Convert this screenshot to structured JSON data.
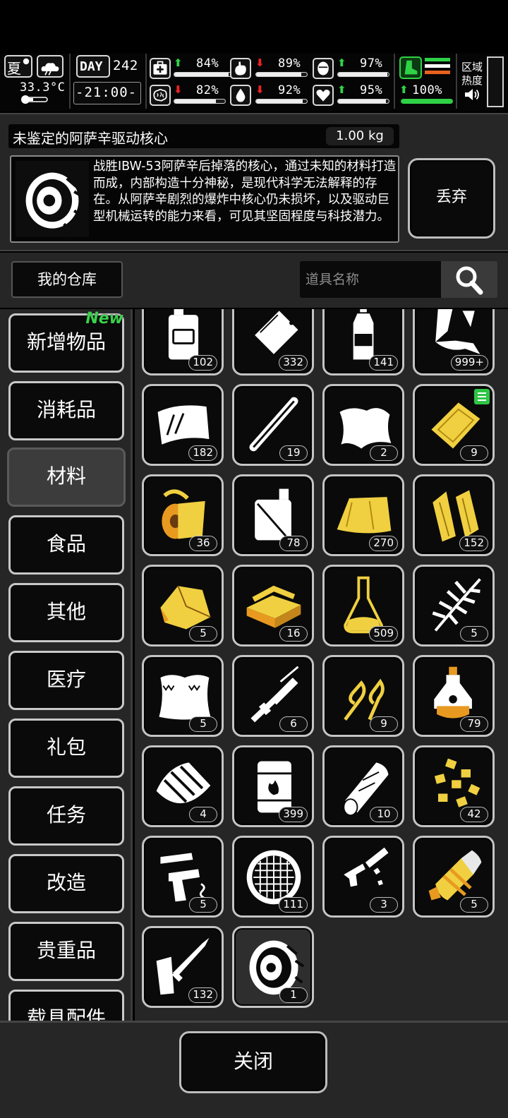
{
  "status": {
    "season": "夏",
    "temperature": "33.3°C",
    "day_label": "DAY",
    "day_number": "242",
    "time": "-21:00-",
    "stats": [
      {
        "name": "health",
        "icon": "medkit-icon",
        "trend": "up",
        "value": "84%",
        "level": 0.84
      },
      {
        "name": "hunger",
        "icon": "stomach-icon",
        "trend": "down",
        "value": "89%",
        "level": 0.89
      },
      {
        "name": "mental",
        "icon": "head-icon",
        "trend": "up",
        "value": "97%",
        "level": 0.97
      },
      {
        "name": "brain",
        "icon": "brain-icon",
        "trend": "down",
        "value": "82%",
        "level": 0.82
      },
      {
        "name": "thirst",
        "icon": "water-drop-icon",
        "trend": "down",
        "value": "92%",
        "level": 0.92
      },
      {
        "name": "mood",
        "icon": "heart-icon",
        "trend": "up",
        "value": "95%",
        "level": 0.95
      }
    ],
    "stamina": {
      "icon": "boot-icon",
      "trend": "up",
      "value": "100%",
      "level": 1.0
    },
    "zone_heat_label": "区域热度",
    "colors": {
      "up": "#31d247",
      "down": "#e22222",
      "accent_orange": "#e8611e"
    }
  },
  "item": {
    "name": "未鉴定的阿萨辛驱动核心",
    "weight": "1.00 kg",
    "icon": "drive-core-icon",
    "description": "战胜IBW-53阿萨辛后掉落的核心，通过未知的材料打造而成，内部构造十分神秘，是现代科学无法解释的存在。从阿萨辛剧烈的爆炸中核心仍未损坏，以及驱动巨型机械运转的能力来看，可见其坚固程度与科技潜力。",
    "discard_label": "丢弃"
  },
  "warehouse": {
    "title": "我的仓库",
    "search_placeholder": "道具名称"
  },
  "categories": [
    {
      "label": "新增物品",
      "badge": "New"
    },
    {
      "label": "消耗品"
    },
    {
      "label": "材料",
      "active": true
    },
    {
      "label": "食品"
    },
    {
      "label": "其他"
    },
    {
      "label": "医疗"
    },
    {
      "label": "礼包"
    },
    {
      "label": "任务"
    },
    {
      "label": "改造"
    },
    {
      "label": "贵重品"
    },
    {
      "label": "载具配件"
    }
  ],
  "items": [
    {
      "icon": "jerrycan-icon",
      "count": "102"
    },
    {
      "icon": "plastic-bag-icon",
      "count": "332"
    },
    {
      "icon": "bottle-icon",
      "count": "141"
    },
    {
      "icon": "cloth-scraps-icon",
      "count": "999+"
    },
    {
      "icon": "glass-sheet-icon",
      "count": "182"
    },
    {
      "icon": "pipe-icon",
      "count": "19"
    },
    {
      "icon": "rags-icon",
      "count": "2"
    },
    {
      "icon": "gold-plate-icon",
      "count": "9",
      "note": true
    },
    {
      "icon": "fabric-roll-icon",
      "count": "36"
    },
    {
      "icon": "canister-icon",
      "count": "78"
    },
    {
      "icon": "gold-cloth-icon",
      "count": "270"
    },
    {
      "icon": "wood-planks-icon",
      "count": "152"
    },
    {
      "icon": "ore-chunk-icon",
      "count": "5"
    },
    {
      "icon": "brick-stack-icon",
      "count": "16"
    },
    {
      "icon": "flask-icon",
      "count": "509"
    },
    {
      "icon": "fern-leaf-icon",
      "count": "5"
    },
    {
      "icon": "fur-pelt-icon",
      "count": "5"
    },
    {
      "icon": "rifle-parts-icon",
      "count": "6"
    },
    {
      "icon": "wire-clip-icon",
      "count": "9"
    },
    {
      "icon": "potion-device-icon",
      "count": "79"
    },
    {
      "icon": "broken-shell-icon",
      "count": "4"
    },
    {
      "icon": "oil-barrel-icon",
      "count": "399"
    },
    {
      "icon": "log-icon",
      "count": "10"
    },
    {
      "icon": "gold-nuggets-icon",
      "count": "42"
    },
    {
      "icon": "pistol-parts-icon",
      "count": "5"
    },
    {
      "icon": "filter-mesh-icon",
      "count": "111"
    },
    {
      "icon": "smg-parts-icon",
      "count": "3"
    },
    {
      "icon": "engine-core-icon",
      "count": "5"
    },
    {
      "icon": "rocket-parts-icon",
      "count": "132"
    },
    {
      "icon": "drive-core-icon",
      "count": "1",
      "selected": true
    }
  ],
  "close_label": "关闭"
}
